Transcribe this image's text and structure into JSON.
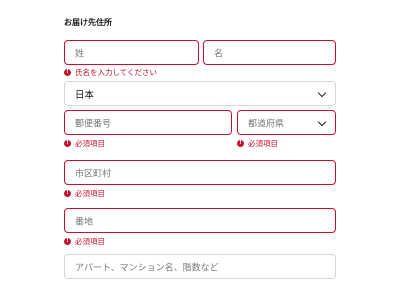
{
  "section": {
    "title": "お届け先住所"
  },
  "name": {
    "last_placeholder": "姓",
    "first_placeholder": "名",
    "error": "氏名を入力してください"
  },
  "country": {
    "selected": "日本"
  },
  "postal": {
    "placeholder": "郵便番号",
    "error": "必須項目"
  },
  "prefecture": {
    "placeholder": "都道府県",
    "error": "必須項目"
  },
  "city": {
    "placeholder": "市区町村",
    "error": "必須項目"
  },
  "street": {
    "placeholder": "番地",
    "error": "必須項目"
  },
  "building": {
    "placeholder": "アパート、マンション名、階数など"
  },
  "icons": {
    "error": "alert-circle-icon",
    "dropdown": "chevron-down-icon"
  },
  "colors": {
    "error": "#c8102e",
    "neutral_border": "#d5d5d5"
  }
}
